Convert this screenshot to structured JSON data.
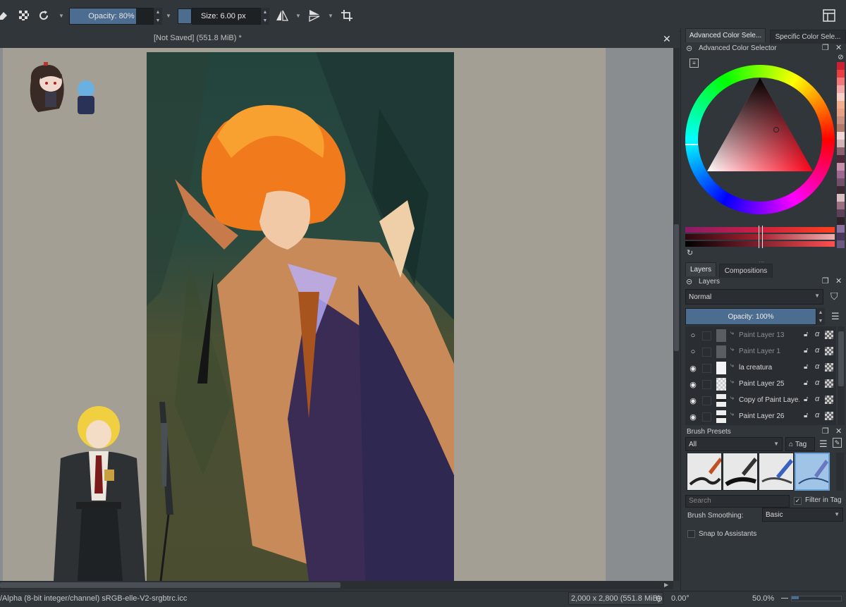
{
  "toolbar": {
    "opacity_label": "Opacity: 80%",
    "opacity_value": 0.8,
    "size_label": "Size: 6.00 px"
  },
  "document": {
    "title": "[Not Saved]  (551.8 MiB) *"
  },
  "status": {
    "color_space": "/Alpha (8-bit integer/channel)  sRGB-elle-V2-srgbtrc.icc",
    "dimensions": "2,000 x 2,800 (551.8 MiB)",
    "rotation": "0.00°",
    "zoom": "50.0%"
  },
  "dock_tabs": {
    "tab1": "Advanced Color Sele...",
    "tab2": "Specific Color Sele..."
  },
  "color_selector": {
    "title": "Advanced Color Selector",
    "swatches": [
      "#cc2030",
      "#e84040",
      "#f07878",
      "#f4a8a8",
      "#f8d0c8",
      "#f0b090",
      "#e8a080",
      "#c89080",
      "#b07868",
      "#f0d8d8",
      "#d4b4b4",
      "#886070",
      "#4a2838",
      "#c890a8",
      "#a06890",
      "#705068",
      "#3c2830",
      "#d8c0c0",
      "#9a7080",
      "#5a4058",
      "#302028",
      "#8a70a0",
      "#483858",
      "#6a5880"
    ],
    "accent": "#4c6c90"
  },
  "layers_tabs": {
    "tab1": "Layers",
    "tab2": "Compositions"
  },
  "layers": {
    "title": "Layers",
    "blend_mode": "Normal",
    "opacity_label": "Opacity:  100%",
    "items": [
      {
        "name": "Paint Layer 13",
        "visible": false
      },
      {
        "name": "Paint Layer 1",
        "visible": false
      },
      {
        "name": "la creatura",
        "visible": true
      },
      {
        "name": "Paint Layer 25",
        "visible": true
      },
      {
        "name": "Copy of Paint Laye...",
        "visible": true
      },
      {
        "name": "Paint Layer 26",
        "visible": true
      }
    ]
  },
  "brush_presets": {
    "title": "Brush Presets",
    "filter": "All",
    "tag_label": "Tag",
    "search_placeholder": "Search",
    "filter_in_tag": "Filter in Tag",
    "smoothing_label": "Brush Smoothing:",
    "smoothing_value": "Basic",
    "snap_label": "Snap to Assistants"
  }
}
